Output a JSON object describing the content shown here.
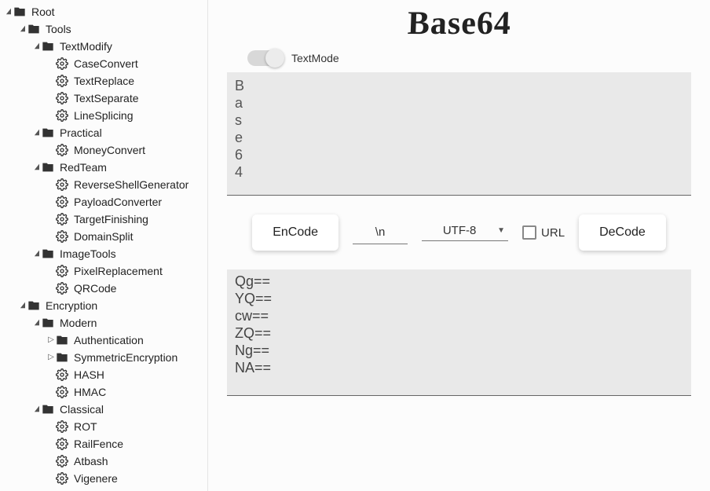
{
  "page_title": "Base64",
  "mode": {
    "label": "TextMode",
    "on": true
  },
  "controls": {
    "encode": "EnCode",
    "decode": "DeCode",
    "separator": "\\n",
    "charset": "UTF-8",
    "url_label": "URL",
    "url_checked": false
  },
  "input_text": "B\na\ns\ne\n6\n4",
  "output_text": "Qg==\nYQ==\ncw==\nZQ==\nNg==\nNA==",
  "tree": [
    {
      "depth": 0,
      "caret": "down",
      "icon": "folder",
      "label": "Root"
    },
    {
      "depth": 1,
      "caret": "down",
      "icon": "folder",
      "label": "Tools"
    },
    {
      "depth": 2,
      "caret": "down",
      "icon": "folder",
      "label": "TextModify"
    },
    {
      "depth": 3,
      "caret": "",
      "icon": "gear",
      "label": "CaseConvert"
    },
    {
      "depth": 3,
      "caret": "",
      "icon": "gear",
      "label": "TextReplace"
    },
    {
      "depth": 3,
      "caret": "",
      "icon": "gear",
      "label": "TextSeparate"
    },
    {
      "depth": 3,
      "caret": "",
      "icon": "gear",
      "label": "LineSplicing"
    },
    {
      "depth": 2,
      "caret": "down",
      "icon": "folder",
      "label": "Practical"
    },
    {
      "depth": 3,
      "caret": "",
      "icon": "gear",
      "label": "MoneyConvert"
    },
    {
      "depth": 2,
      "caret": "down",
      "icon": "folder",
      "label": "RedTeam"
    },
    {
      "depth": 3,
      "caret": "",
      "icon": "gear",
      "label": "ReverseShellGenerator"
    },
    {
      "depth": 3,
      "caret": "",
      "icon": "gear",
      "label": "PayloadConverter"
    },
    {
      "depth": 3,
      "caret": "",
      "icon": "gear",
      "label": "TargetFinishing"
    },
    {
      "depth": 3,
      "caret": "",
      "icon": "gear",
      "label": "DomainSplit"
    },
    {
      "depth": 2,
      "caret": "down",
      "icon": "folder",
      "label": "ImageTools"
    },
    {
      "depth": 3,
      "caret": "",
      "icon": "gear",
      "label": "PixelReplacement"
    },
    {
      "depth": 3,
      "caret": "",
      "icon": "gear",
      "label": "QRCode"
    },
    {
      "depth": 1,
      "caret": "down",
      "icon": "folder",
      "label": "Encryption"
    },
    {
      "depth": 2,
      "caret": "down",
      "icon": "folder",
      "label": "Modern"
    },
    {
      "depth": 3,
      "caret": "right",
      "icon": "folder",
      "label": "Authentication"
    },
    {
      "depth": 3,
      "caret": "right",
      "icon": "folder",
      "label": "SymmetricEncryption"
    },
    {
      "depth": 3,
      "caret": "",
      "icon": "gear",
      "label": "HASH"
    },
    {
      "depth": 3,
      "caret": "",
      "icon": "gear",
      "label": "HMAC"
    },
    {
      "depth": 2,
      "caret": "down",
      "icon": "folder",
      "label": "Classical"
    },
    {
      "depth": 3,
      "caret": "",
      "icon": "gear",
      "label": "ROT"
    },
    {
      "depth": 3,
      "caret": "",
      "icon": "gear",
      "label": "RailFence"
    },
    {
      "depth": 3,
      "caret": "",
      "icon": "gear",
      "label": "Atbash"
    },
    {
      "depth": 3,
      "caret": "",
      "icon": "gear",
      "label": "Vigenere"
    }
  ],
  "icons": {
    "folder": "folder-icon",
    "gear": "gear-icon"
  },
  "colors": {
    "panel_bg": "#e9e9e9",
    "page_bg": "#fcfcfc",
    "button_bg": "#ffffff",
    "text": "#222222"
  }
}
